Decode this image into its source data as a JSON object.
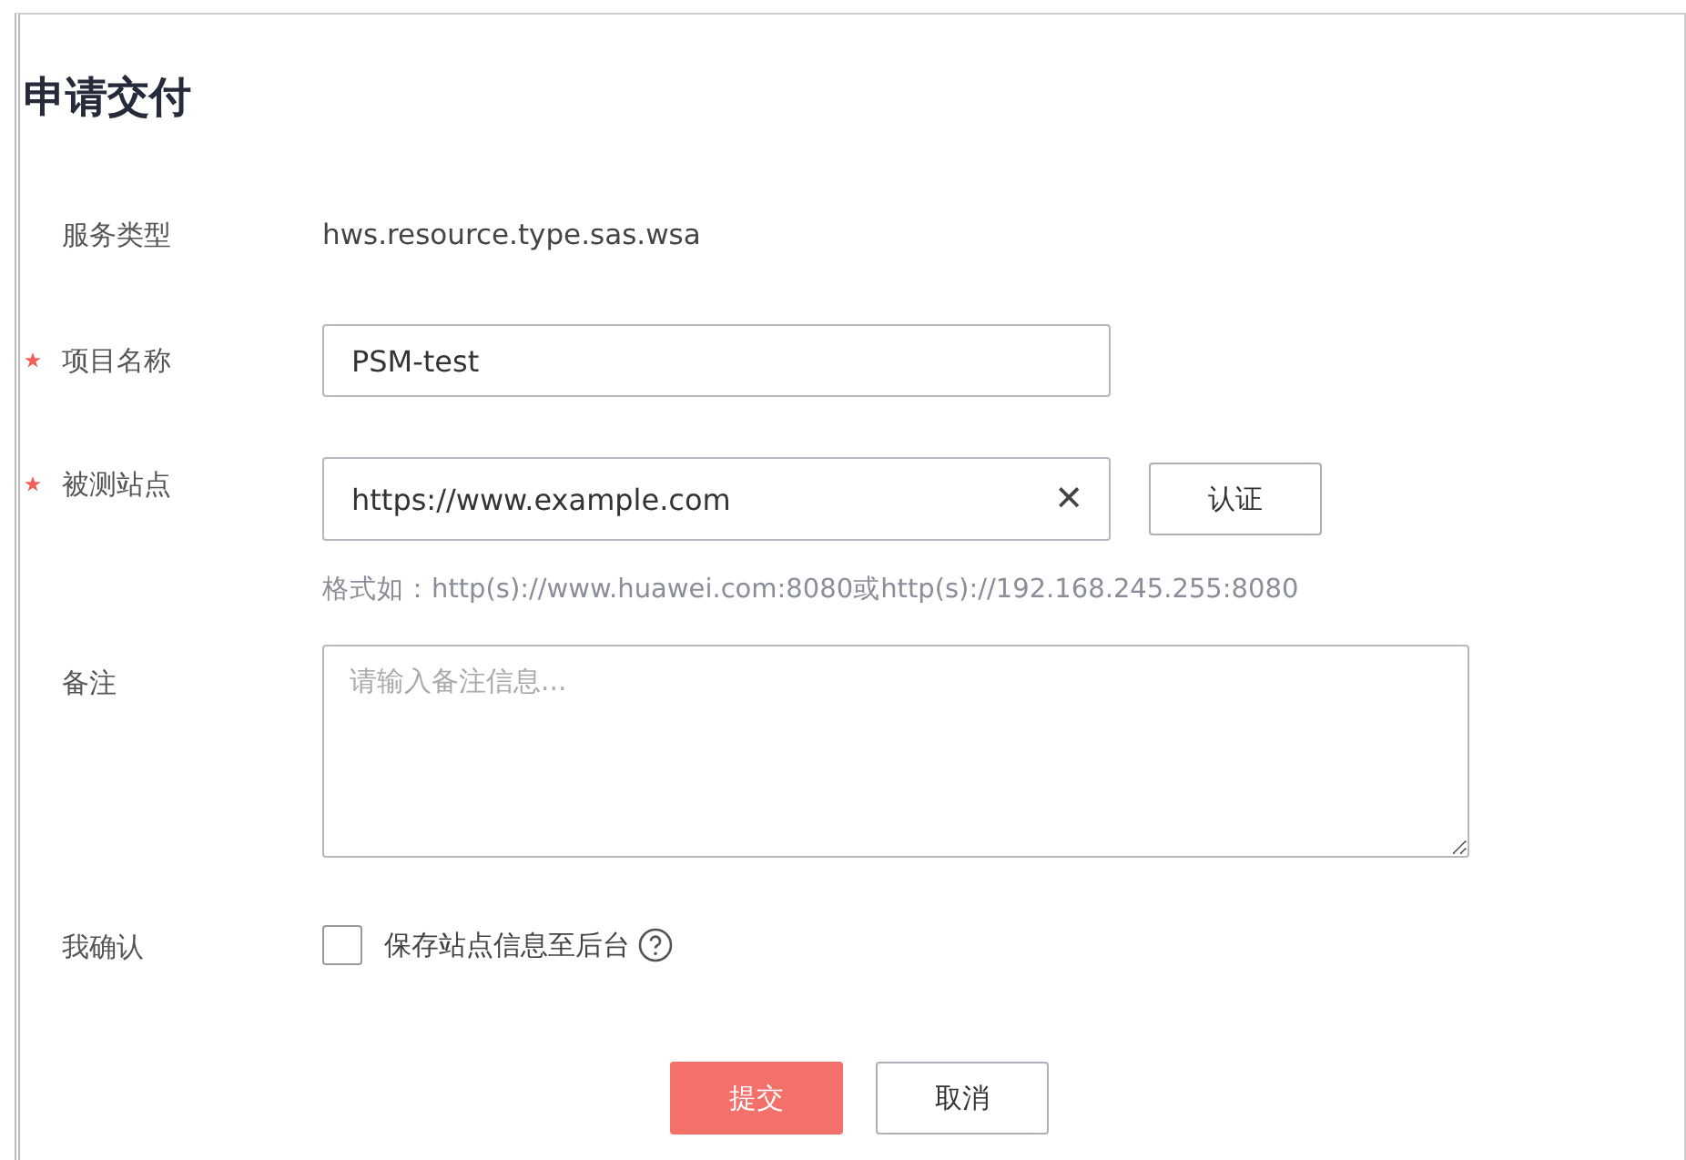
{
  "title": "申请交付",
  "fields": [
    {
      "kind": "text",
      "label": "服务类型",
      "required": false,
      "value": "hws.resource.type.sas.wsa"
    },
    {
      "kind": "input",
      "label": "项目名称",
      "required": true,
      "value": "PSM-test"
    },
    {
      "kind": "input-clear",
      "label": "被测站点",
      "required": true,
      "value": "https://www.example.com",
      "clear": "✕",
      "action": "认证",
      "hint": "格式如：http(s)://www.huawei.com:8080或http(s)://192.168.245.255:8080"
    },
    {
      "kind": "textarea",
      "label": "备注",
      "required": false,
      "placeholder": "请输入备注信息..."
    },
    {
      "kind": "checkbox",
      "label": "我确认",
      "required": false,
      "checked": false,
      "text": "保存站点信息至后台"
    }
  ],
  "buttons": [
    {
      "label": "提交",
      "primary": true
    },
    {
      "label": "取消",
      "primary": false
    }
  ]
}
